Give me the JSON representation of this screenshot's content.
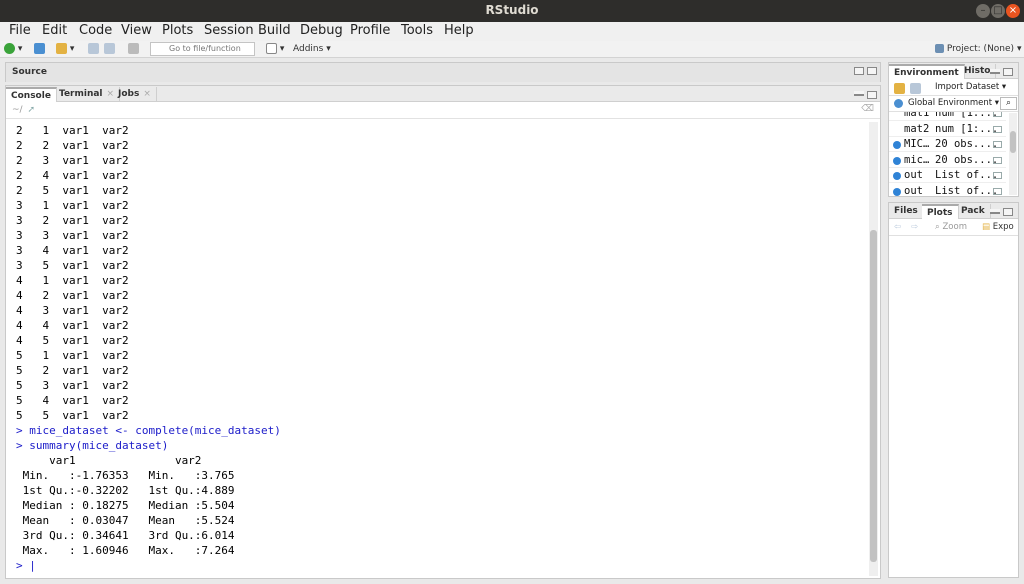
{
  "window": {
    "title": "RStudio"
  },
  "menu": [
    "File",
    "Edit",
    "Code",
    "View",
    "Plots",
    "Session",
    "Build",
    "Debug",
    "Profile",
    "Tools",
    "Help"
  ],
  "toolbar": {
    "goto_placeholder": "Go to file/function",
    "addins": "Addins",
    "project": "Project: (None)"
  },
  "source_pane": {
    "title": "Source"
  },
  "console_pane": {
    "tabs": [
      {
        "label": "Console"
      },
      {
        "label": "Terminal"
      },
      {
        "label": "Jobs"
      }
    ],
    "path": "~/",
    "lines": [
      {
        "text": "2   1  var1  var2",
        "kind": "out"
      },
      {
        "text": "2   2  var1  var2",
        "kind": "out"
      },
      {
        "text": "2   3  var1  var2",
        "kind": "out"
      },
      {
        "text": "2   4  var1  var2",
        "kind": "out"
      },
      {
        "text": "2   5  var1  var2",
        "kind": "out"
      },
      {
        "text": "3   1  var1  var2",
        "kind": "out"
      },
      {
        "text": "3   2  var1  var2",
        "kind": "out"
      },
      {
        "text": "3   3  var1  var2",
        "kind": "out"
      },
      {
        "text": "3   4  var1  var2",
        "kind": "out"
      },
      {
        "text": "3   5  var1  var2",
        "kind": "out"
      },
      {
        "text": "4   1  var1  var2",
        "kind": "out"
      },
      {
        "text": "4   2  var1  var2",
        "kind": "out"
      },
      {
        "text": "4   3  var1  var2",
        "kind": "out"
      },
      {
        "text": "4   4  var1  var2",
        "kind": "out"
      },
      {
        "text": "4   5  var1  var2",
        "kind": "out"
      },
      {
        "text": "5   1  var1  var2",
        "kind": "out"
      },
      {
        "text": "5   2  var1  var2",
        "kind": "out"
      },
      {
        "text": "5   3  var1  var2",
        "kind": "out"
      },
      {
        "text": "5   4  var1  var2",
        "kind": "out"
      },
      {
        "text": "5   5  var1  var2",
        "kind": "out"
      },
      {
        "text": "> mice_dataset <- complete(mice_dataset)",
        "kind": "cmd"
      },
      {
        "text": "> summary(mice_dataset)",
        "kind": "cmd"
      },
      {
        "text": "     var1               var2      ",
        "kind": "out"
      },
      {
        "text": " Min.   :-1.76353   Min.   :3.765  ",
        "kind": "out"
      },
      {
        "text": " 1st Qu.:-0.32202   1st Qu.:4.889  ",
        "kind": "out"
      },
      {
        "text": " Median : 0.18275   Median :5.504  ",
        "kind": "out"
      },
      {
        "text": " Mean   : 0.03047   Mean   :5.524  ",
        "kind": "out"
      },
      {
        "text": " 3rd Qu.: 0.34641   3rd Qu.:6.014  ",
        "kind": "out"
      },
      {
        "text": " Max.   : 1.60946   Max.   :7.264  ",
        "kind": "out"
      },
      {
        "text": "> |",
        "kind": "cmd"
      }
    ]
  },
  "env_pane": {
    "tabs": [
      {
        "label": "Environment"
      },
      {
        "label": "Histo"
      }
    ],
    "import_label": "Import Dataset",
    "scope_label": "Global Environment",
    "rows": [
      {
        "name": "mat1",
        "value": "num [1:..."
      },
      {
        "name": "mat2",
        "value": "num [1:..."
      },
      {
        "name": "MIC…",
        "value": "20 obs...."
      },
      {
        "name": "mic…",
        "value": "20 obs...."
      },
      {
        "name": "out",
        "value": "List of..."
      },
      {
        "name": "out",
        "value": "List of..."
      }
    ]
  },
  "files_pane": {
    "tabs": [
      {
        "label": "Files"
      },
      {
        "label": "Plots"
      },
      {
        "label": "Pack"
      }
    ],
    "zoom_label": "Zoom",
    "export_label": "Expo"
  }
}
